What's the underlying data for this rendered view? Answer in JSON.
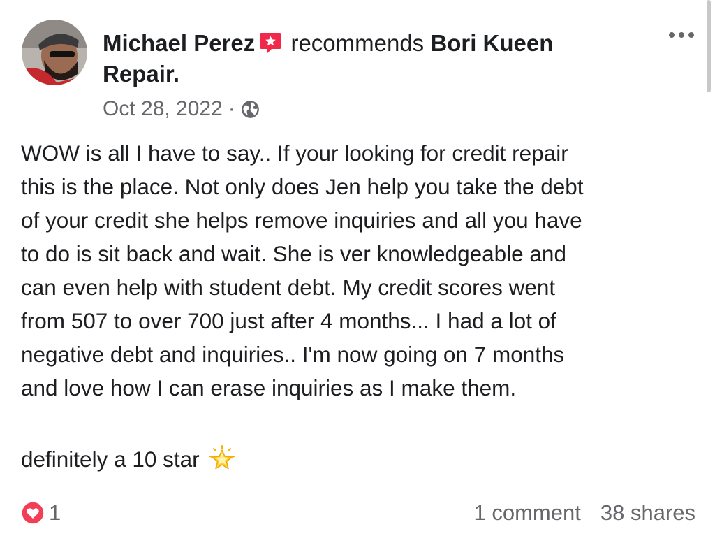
{
  "post": {
    "author_name": "Michael Perez",
    "recommends_text": "recommends",
    "page_name": "Bori Kueen",
    "page_name_cont": "Repair.",
    "date": "Oct 28, 2022",
    "separator": "·",
    "body_lines": [
      "WOW is all I have to say.. If your looking for credit repair",
      "this is the place. Not only does Jen help you take the debt",
      "of your credit she helps remove inquiries and all you have",
      "to do is sit back and wait. She is ver knowledgeable and",
      "can even help with student debt. My credit scores went",
      "from 507 to over 700 just after 4 months... I had a lot of",
      "negative debt and inquiries.. I'm now going on 7 months",
      "and love how I can erase inquiries as I make them."
    ],
    "rating_text": "definitely a 10 star",
    "rating_icon": "glowing-star-icon",
    "privacy_icon": "globe-icon",
    "more_icon": "more-options-icon",
    "badge_icon": "recommendation-badge-icon"
  },
  "footer": {
    "reaction_icon": "love-reaction-icon",
    "reaction_count": "1",
    "comments": "1 comment",
    "shares": "38 shares"
  },
  "colors": {
    "text_primary": "#1c1e21",
    "text_secondary": "#65676b",
    "badge": "#f0284a",
    "love": "#f33e58"
  }
}
